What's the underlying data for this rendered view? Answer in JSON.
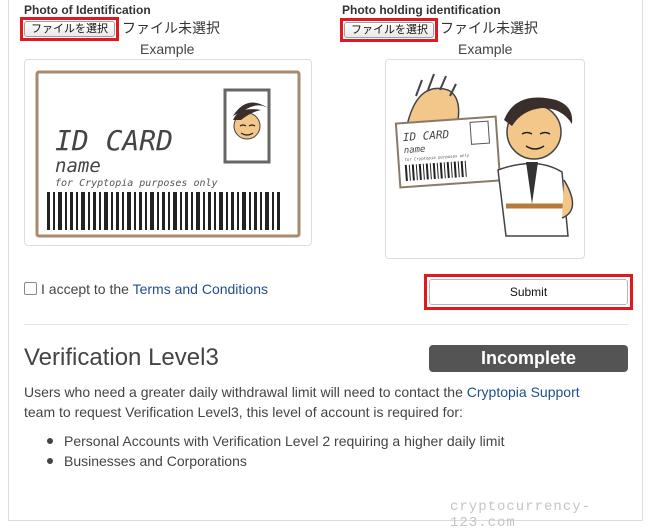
{
  "upload_identification": {
    "heading": "Photo of Identification",
    "button_label": "ファイルを選択",
    "file_status": "ファイル未選択",
    "example_label": "Example",
    "image": {
      "card_title": "ID CARD",
      "card_name": "name",
      "card_note": "for Cryptopia purposes only"
    }
  },
  "upload_holding": {
    "heading": "Photo holding identification",
    "button_label": "ファイルを選択",
    "file_status": "ファイル未選択",
    "example_label": "Example",
    "image": {
      "card_title": "ID CARD",
      "card_name": "name",
      "card_note": "for Cryptopia purposes only"
    }
  },
  "terms": {
    "checked": false,
    "text": "I accept to the",
    "link_text": "Terms and Conditions"
  },
  "submit_label": "Submit",
  "level3": {
    "title": "Verification Level3",
    "status_badge": "Incomplete",
    "status_color": "#545454",
    "description_before": "Users who need a greater daily withdrawal limit will need to contact the",
    "support_link": "Cryptopia Support",
    "description_after": "team to request Verification Level3, this level of account is required for:",
    "requirements": [
      "Personal Accounts with Verification Level 2 requiring a higher daily limit",
      "Businesses and Corporations"
    ]
  },
  "watermark": "cryptocurrency-123.com",
  "colors": {
    "highlight": "#e0191f",
    "link": "#1f4e8c",
    "card_border": "#a88a6d"
  }
}
